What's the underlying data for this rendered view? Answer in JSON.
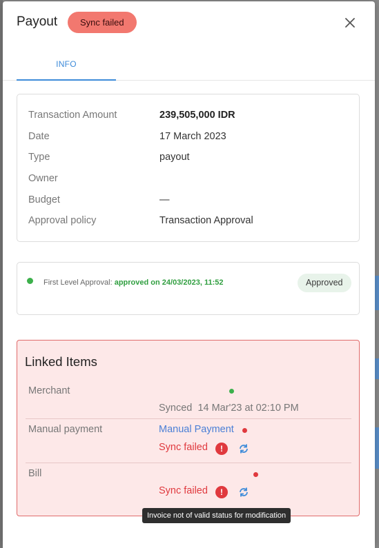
{
  "header": {
    "title": "Payout",
    "status_badge": "Sync failed"
  },
  "tabs": [
    {
      "label": "INFO",
      "active": true
    }
  ],
  "info": {
    "rows": [
      {
        "label": "Transaction Amount",
        "value": "239,505,000 IDR"
      },
      {
        "label": "Date",
        "value": "17 March 2023"
      },
      {
        "label": "Type",
        "value": "payout"
      },
      {
        "label": "Owner",
        "value": ""
      },
      {
        "label": "Budget",
        "value": "—"
      },
      {
        "label": "Approval policy",
        "value": "Transaction Approval"
      }
    ]
  },
  "approval": {
    "level_label": "First Level Approval:",
    "status_text": "approved on 24/03/2023, 11:52",
    "pill": "Approved"
  },
  "linked_items": {
    "title": "Linked Items",
    "merchant": {
      "label": "Merchant",
      "status": "Synced",
      "timestamp": "14 Mar'23 at 02:10 PM"
    },
    "manual_payment": {
      "label": "Manual payment",
      "link_text": "Manual Payment",
      "status": "Sync failed"
    },
    "bill": {
      "label": "Bill",
      "status": "Sync failed"
    }
  },
  "tooltip": "Invoice not of valid status for modification",
  "colors": {
    "accent": "#3d8bd9",
    "error": "#e0393e",
    "success": "#3cb04b",
    "badge_bg": "#f2786f"
  }
}
